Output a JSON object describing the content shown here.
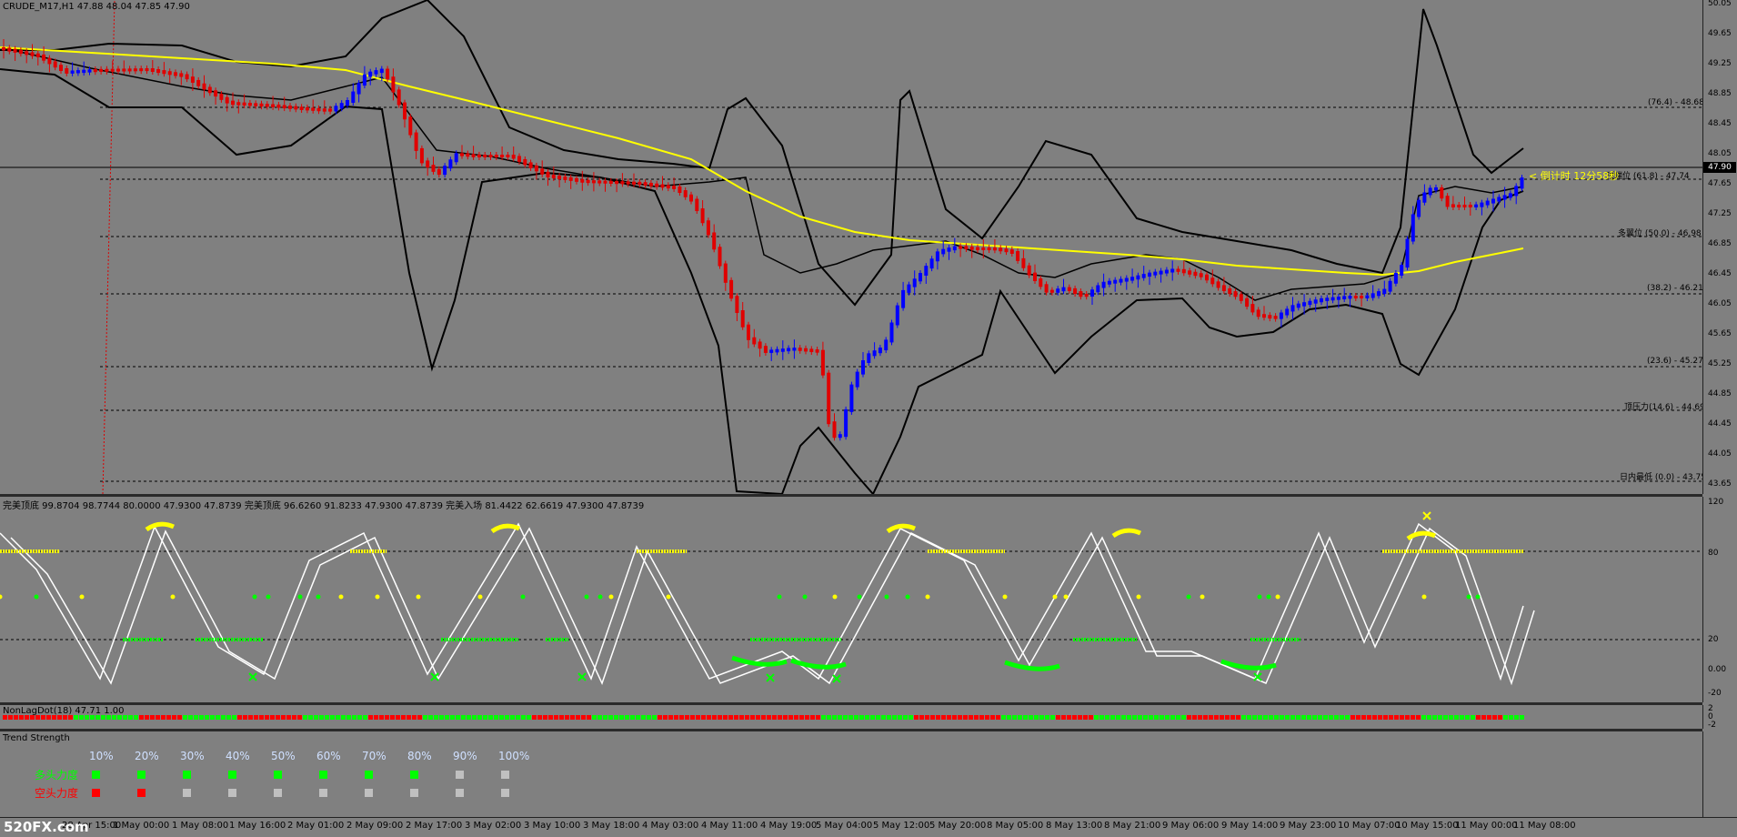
{
  "main_chart": {
    "title": "CRUDE_M17,H1  47.88 48.04 47.85 47.90",
    "current_price": "47.90",
    "countdown": "< 倒计时 12分58秒",
    "price_ticks": [
      "50.05",
      "49.65",
      "49.25",
      "48.85",
      "48.45",
      "48.05",
      "47.65",
      "47.25",
      "46.85",
      "46.45",
      "46.05",
      "45.65",
      "45.25",
      "44.85",
      "44.45",
      "44.05",
      "43.65"
    ],
    "fib_levels": [
      {
        "label": "(76.4) - 48.68"
      },
      {
        "label": "顶端位 (61.8) - 47.74"
      },
      {
        "label": "多翼位 (50.0) - 46.98"
      },
      {
        "label": "(38.2) - 46.21"
      },
      {
        "label": "(23.6) - 45.27"
      },
      {
        "label": "顶压力(14.6) - 44.69"
      },
      {
        "label": "日内最低 (0.0) - 43.75"
      }
    ],
    "colors": {
      "bull": "#0000ff",
      "bear": "#e00000",
      "ma": "#ffff00",
      "band": "#000000"
    }
  },
  "osc_panel": {
    "title": "完美顶底 99.8704 98.7744 80.0000 47.9300 47.8739   完美顶底 96.6260 91.8233 47.9300 47.8739   完美入场 81.4422 62.6619 47.9300 47.8739",
    "ticks": [
      "120",
      "80",
      "20",
      "0.00",
      "-20"
    ]
  },
  "nonlag_panel": {
    "title": "NonLagDot(18) 47.71 1.00",
    "ticks": [
      "2",
      "0",
      "-2"
    ]
  },
  "trend_panel": {
    "title": "Trend Strength",
    "percent_labels": [
      "10%",
      "20%",
      "30%",
      "40%",
      "50%",
      "60%",
      "70%",
      "80%",
      "90%",
      "100%"
    ],
    "bull_label": "多头力度",
    "bear_label": "空头力度",
    "bull_levels": 8,
    "bear_levels": 2,
    "colors": {
      "bull": "#00ff00",
      "bear": "#ff0000",
      "empty": "#c0c0c0"
    }
  },
  "x_axis_labels": [
    "28 Apr 15:00",
    "1 May 00:00",
    "1 May 08:00",
    "1 May 16:00",
    "2 May 01:00",
    "2 May 09:00",
    "2 May 17:00",
    "3 May 02:00",
    "3 May 10:00",
    "3 May 18:00",
    "4 May 03:00",
    "4 May 11:00",
    "4 May 19:00",
    "5 May 04:00",
    "5 May 12:00",
    "5 May 20:00",
    "8 May 05:00",
    "8 May 13:00",
    "8 May 21:00",
    "9 May 06:00",
    "9 May 14:00",
    "9 May 23:00",
    "10 May 07:00",
    "10 May 15:00",
    "11 May 00:00",
    "11 May 08:00"
  ],
  "watermark": "520FX.com"
}
